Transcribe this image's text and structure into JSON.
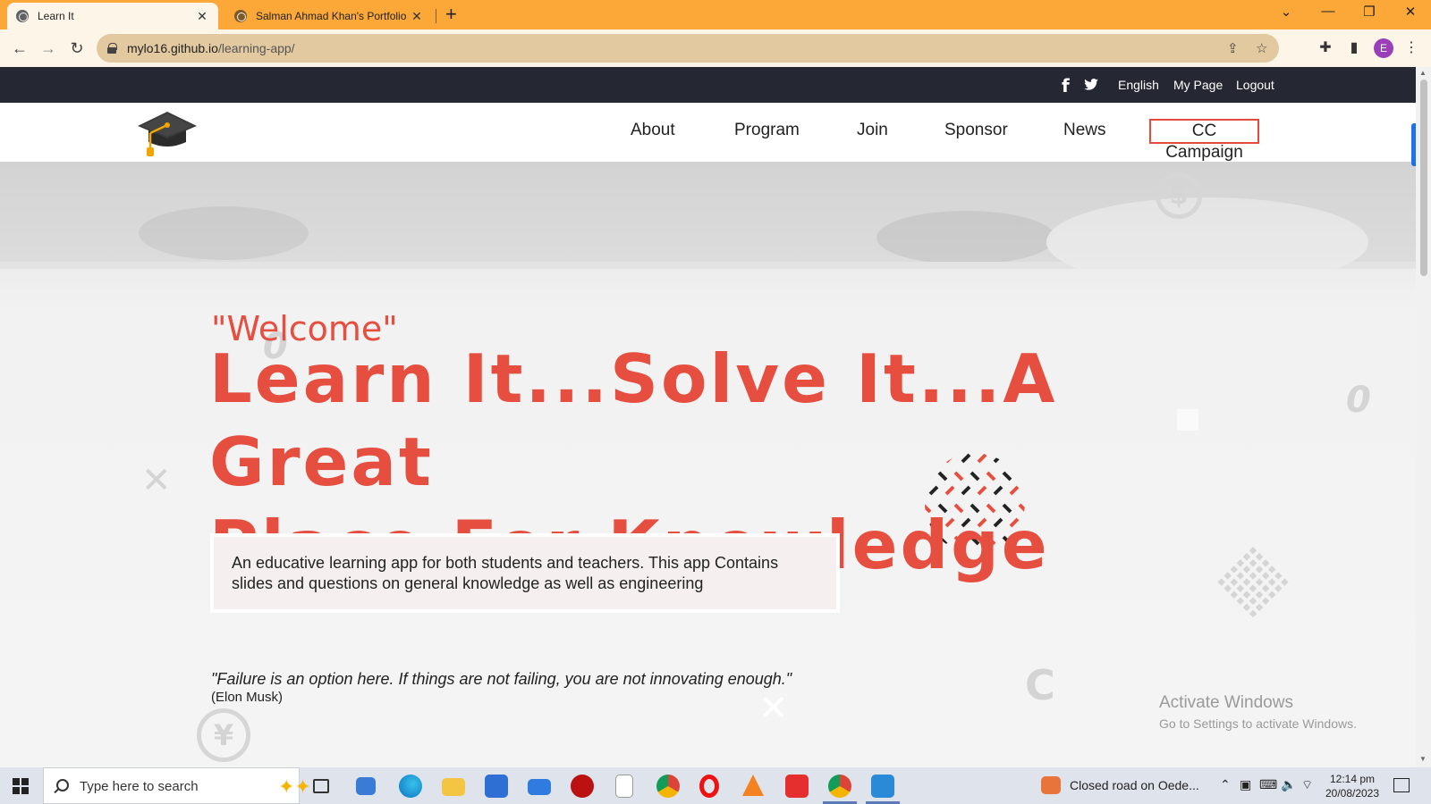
{
  "browser": {
    "tabs": [
      {
        "title": "Learn It"
      },
      {
        "title": "Salman Ahmad Khan's Portfolio"
      }
    ],
    "url_host": "mylo16.github.io",
    "url_path": "/learning-app/"
  },
  "site": {
    "topbar": {
      "language": "English",
      "my_page": "My Page",
      "logout": "Logout"
    },
    "nav": {
      "items": [
        "About",
        "Program",
        "Join",
        "Sponsor",
        "News"
      ],
      "highlight": "CC Campaign"
    },
    "hero": {
      "welcome": "\"Welcome\"",
      "headline_line1": "Learn It...Solve It...A Great",
      "headline_line2": "Place For Knowledge",
      "description": "An educative learning app for both students and teachers. This app Contains slides and questions on general knowledge as well as engineering",
      "quote": "\"Failure is an option here. If things are not failing, you are not innovating enough.\"",
      "author": "(Elon Musk)"
    },
    "accent_color": "#e64e40"
  },
  "windows": {
    "activate_title": "Activate Windows",
    "activate_subtitle": "Go to Settings to activate Windows.",
    "search_placeholder": "Type here to search",
    "notification": "Closed road on Oede...",
    "time": "12:14 pm",
    "date": "20/08/2023"
  }
}
